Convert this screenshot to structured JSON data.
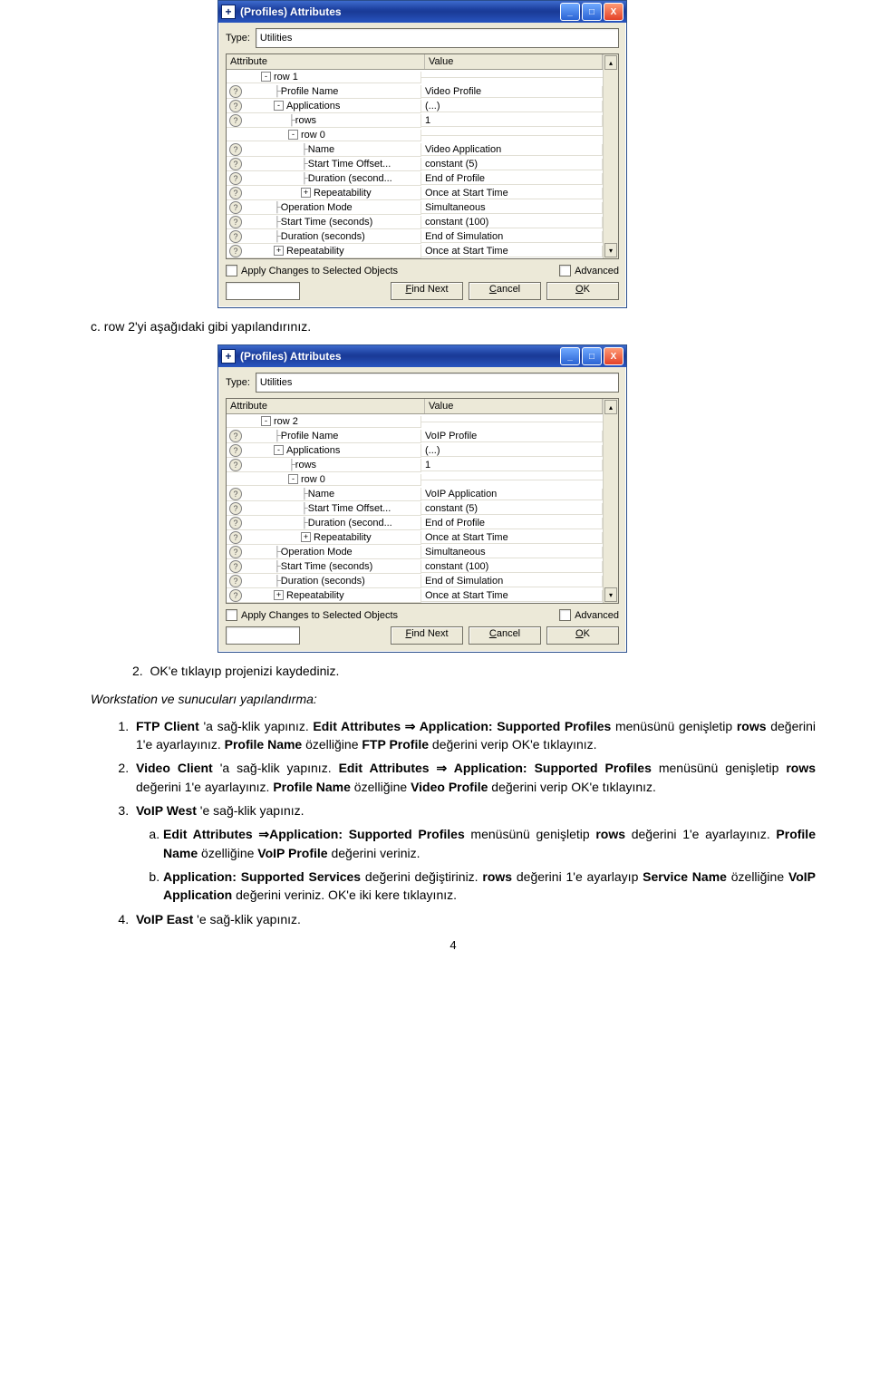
{
  "windows": [
    {
      "title": "(Profiles) Attributes",
      "type_label": "Type:",
      "type_value": "Utilities",
      "header_attr": "Attribute",
      "header_val": "Value",
      "apply_label": "Apply Changes to Selected Objects",
      "advanced_label": "Advanced",
      "find_next": "Find Next",
      "cancel": "Cancel",
      "ok": "OK",
      "rows": [
        {
          "q": 0,
          "indent": 18,
          "pm": "-",
          "label": "row 1",
          "val": ""
        },
        {
          "q": 1,
          "indent": 32,
          "tree": "├",
          "label": "Profile Name",
          "val": "Video Profile"
        },
        {
          "q": 1,
          "indent": 32,
          "pm": "-",
          "label": "Applications",
          "val": "(...)"
        },
        {
          "q": 1,
          "indent": 48,
          "tree": "├",
          "label": "rows",
          "val": "1"
        },
        {
          "q": 0,
          "indent": 48,
          "pm": "-",
          "label": "row 0",
          "val": ""
        },
        {
          "q": 1,
          "indent": 62,
          "tree": "├",
          "label": "Name",
          "val": "Video Application"
        },
        {
          "q": 1,
          "indent": 62,
          "tree": "├",
          "label": "Start Time Offset...",
          "val": "constant (5)"
        },
        {
          "q": 1,
          "indent": 62,
          "tree": "├",
          "label": "Duration (second...",
          "val": "End of Profile"
        },
        {
          "q": 1,
          "indent": 62,
          "pm": "+",
          "label": "Repeatability",
          "val": "Once at Start Time"
        },
        {
          "q": 1,
          "indent": 32,
          "tree": "├",
          "label": "Operation Mode",
          "val": "Simultaneous"
        },
        {
          "q": 1,
          "indent": 32,
          "tree": "├",
          "label": "Start Time (seconds)",
          "val": "constant (100)"
        },
        {
          "q": 1,
          "indent": 32,
          "tree": "├",
          "label": "Duration (seconds)",
          "val": "End of Simulation"
        },
        {
          "q": 1,
          "indent": 32,
          "pm": "+",
          "label": "Repeatability",
          "val": "Once at Start Time"
        }
      ]
    },
    {
      "title": "(Profiles) Attributes",
      "type_label": "Type:",
      "type_value": "Utilities",
      "header_attr": "Attribute",
      "header_val": "Value",
      "apply_label": "Apply Changes to Selected Objects",
      "advanced_label": "Advanced",
      "find_next": "Find Next",
      "cancel": "Cancel",
      "ok": "OK",
      "rows": [
        {
          "q": 0,
          "indent": 18,
          "pm": "-",
          "label": "row 2",
          "val": ""
        },
        {
          "q": 1,
          "indent": 32,
          "tree": "├",
          "label": "Profile Name",
          "val": "VoIP Profile"
        },
        {
          "q": 1,
          "indent": 32,
          "pm": "-",
          "label": "Applications",
          "val": "(...)"
        },
        {
          "q": 1,
          "indent": 48,
          "tree": "├",
          "label": "rows",
          "val": "1"
        },
        {
          "q": 0,
          "indent": 48,
          "pm": "-",
          "label": "row 0",
          "val": ""
        },
        {
          "q": 1,
          "indent": 62,
          "tree": "├",
          "label": "Name",
          "val": "VoIP Application"
        },
        {
          "q": 1,
          "indent": 62,
          "tree": "├",
          "label": "Start Time Offset...",
          "val": "constant (5)"
        },
        {
          "q": 1,
          "indent": 62,
          "tree": "├",
          "label": "Duration (second...",
          "val": "End of Profile"
        },
        {
          "q": 1,
          "indent": 62,
          "pm": "+",
          "label": "Repeatability",
          "val": "Once at Start Time"
        },
        {
          "q": 1,
          "indent": 32,
          "tree": "├",
          "label": "Operation Mode",
          "val": "Simultaneous"
        },
        {
          "q": 1,
          "indent": 32,
          "tree": "├",
          "label": "Start Time (seconds)",
          "val": "constant (100)"
        },
        {
          "q": 1,
          "indent": 32,
          "tree": "├",
          "label": "Duration (seconds)",
          "val": "End of Simulation"
        },
        {
          "q": 1,
          "indent": 32,
          "pm": "+",
          "label": "Repeatability",
          "val": "Once at Start Time"
        }
      ]
    }
  ],
  "text": {
    "c": "c.  row 2'yi aşağıdaki gibi yapılandırınız.",
    "step2": "OK'e tıklayıp projenizi kaydediniz.",
    "heading": "Workstation ve sunucuları yapılandırma:",
    "li1a": "FTP Client",
    "li1b": " 'a sağ-klik yapınız. ",
    "li1c": "Edit Attributes ⇒ Application: Supported Profiles",
    "li1d": " menüsünü genişletip ",
    "li1e": "rows",
    "li1f": " değerini 1'e ayarlayınız. ",
    "li1g": "Profile Name",
    "li1h": " özelliğine ",
    "li1i": "FTP Profile",
    "li1j": " değerini verip OK'e tıklayınız.",
    "li2a": "Video Client",
    "li2b": " 'a sağ-klik yapınız. ",
    "li2c": "Edit Attributes ⇒ Application: Supported Profiles",
    "li2d": " menüsünü genişletip ",
    "li2e": "rows",
    "li2f": " değerini 1'e ayarlayınız. ",
    "li2g": "Profile Name",
    "li2h": " özelliğine ",
    "li2i": "Video Profile",
    "li2j": " değerini verip OK'e tıklayınız.",
    "li3a": "VoIP West",
    "li3b": " 'e sağ-klik yapınız.",
    "li3aa1": "Edit Attributes ⇒Application: Supported Profiles",
    "li3aa2": " menüsünü genişletip ",
    "li3aa3": "rows",
    "li3aa4": " değerini 1'e ayarlayınız. ",
    "li3aa5": "Profile Name",
    "li3aa6": " özelliğine ",
    "li3aa7": "VoIP Profile",
    "li3aa8": " değerini veriniz.",
    "li3bb1": "Application: Supported Services",
    "li3bb2": " değerini değiştiriniz. ",
    "li3bb3": "rows",
    "li3bb4": " değerini 1'e ayarlayıp ",
    "li3bb5": "Service Name",
    "li3bb6": " özelliğine ",
    "li3bb7": "VoIP Application",
    "li3bb8": " değerini veriniz. OK'e iki kere tıklayınız.",
    "li4a": "VoIP East",
    "li4b": " 'e sağ-klik yapınız.",
    "page": "4"
  }
}
